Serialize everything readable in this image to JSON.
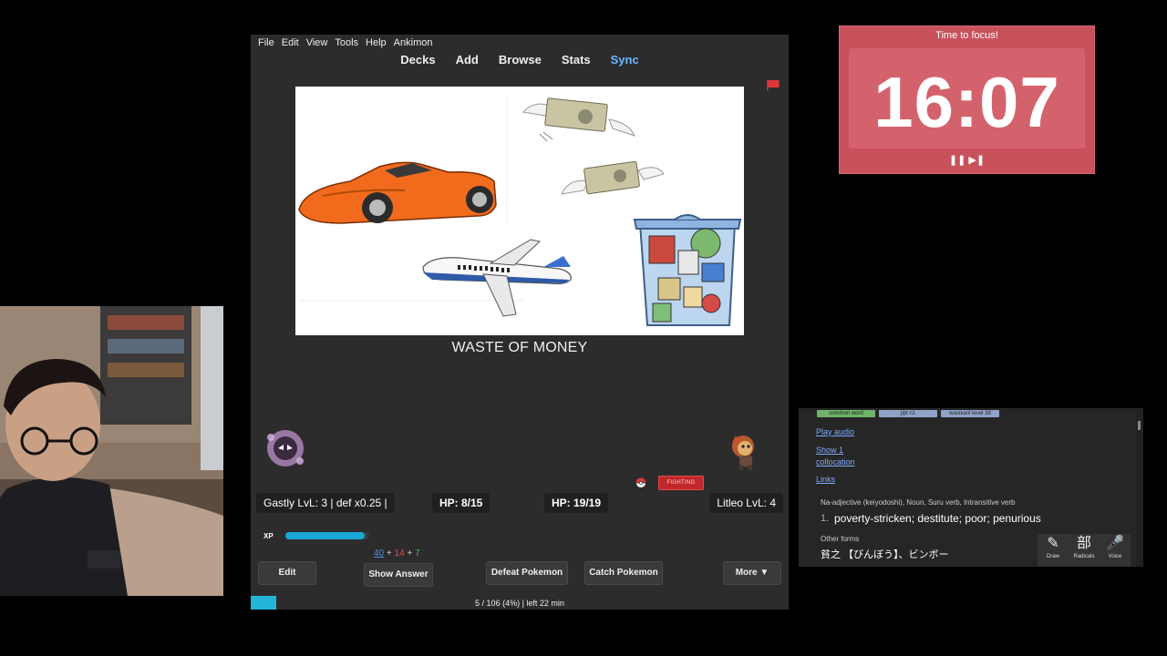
{
  "anki": {
    "menu": [
      "File",
      "Edit",
      "View",
      "Tools",
      "Help",
      "Ankimon"
    ],
    "toolbar": {
      "decks": "Decks",
      "add": "Add",
      "browse": "Browse",
      "stats": "Stats",
      "sync": "Sync"
    },
    "card_text": "WASTE OF MONEY",
    "battle": {
      "player": "Gastly LvL: 3 | def x0.25 |",
      "player_hp": "HP: 8/15",
      "enemy_hp": "HP: 19/19",
      "enemy": "Litleo LvL: 4",
      "enemy_type": "FIGHTING",
      "xp_label": "XP",
      "xp_fraction": 0.95
    },
    "counts": {
      "new": "40",
      "learn": "14",
      "review": "7",
      "plus": "+"
    },
    "buttons": {
      "edit": "Edit",
      "show_answer": "Show Answer",
      "defeat": "Defeat Pokemon",
      "catch": "Catch Pokemon",
      "more": "More ▼"
    },
    "progress": {
      "text": "5 / 106 (4%) | left 22 min",
      "fraction": 0.047
    }
  },
  "timer": {
    "title": "Time to focus!",
    "time": "16:07",
    "controls": "❚❚ ▶❚",
    "color": "#c9515c"
  },
  "dict": {
    "tags": [
      "common word",
      "jlpt n1",
      "wanikani level 38"
    ],
    "play_audio": "Play audio",
    "show_collocation_1": "Show 1",
    "show_collocation_2": "collocation",
    "links": "Links",
    "pos": "Na-adjective (keiyodoshi), Noun, Suru verb, Intransitive verb",
    "def_num": "1.",
    "definition": "poverty-stricken; destitute; poor; penurious",
    "other_forms_label": "Other forms",
    "other_forms": "貧之 【びんぼう】、ビンボー",
    "tools": [
      {
        "icon": "✎",
        "label": "Draw"
      },
      {
        "icon": "部",
        "label": "Radicals"
      },
      {
        "icon": "🎤",
        "label": "Voice"
      }
    ]
  }
}
